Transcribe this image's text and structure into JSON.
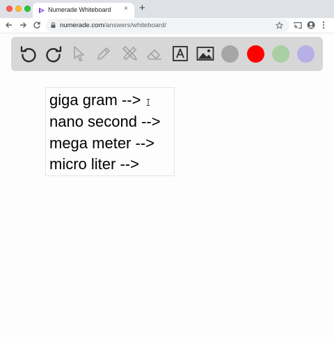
{
  "browser": {
    "tab_title": "Numerade Whiteboard",
    "tab_close": "×",
    "new_tab": "+",
    "url_host": "numerade.com",
    "url_path": "/answers/whiteboard/"
  },
  "toolbar": {
    "tools": [
      "undo-icon",
      "redo-icon",
      "pointer-icon",
      "pencil-icon",
      "tools-icon",
      "eraser-icon",
      "text-tool-icon",
      "image-icon"
    ],
    "colors": [
      "#a6a6a6",
      "#ff0000",
      "#a9cfa4",
      "#b6b0e6"
    ]
  },
  "whiteboard": {
    "lines": [
      "giga gram -->",
      "nano second -->",
      "mega meter -->",
      "micro liter -->"
    ]
  }
}
